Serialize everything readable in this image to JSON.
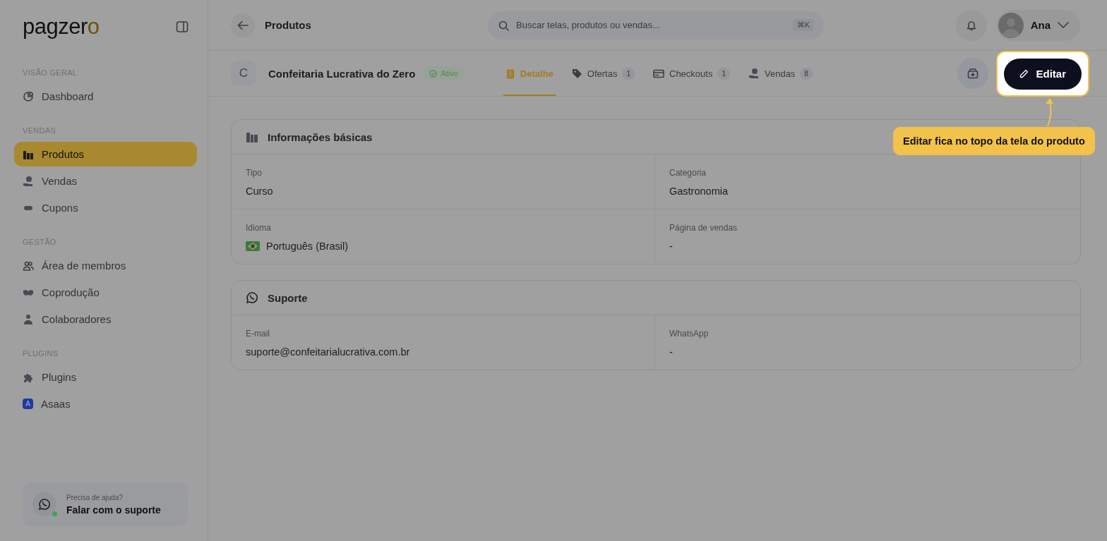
{
  "logo": {
    "text": "pagzero"
  },
  "sidebar": {
    "sections": [
      {
        "title": "VISÃO GERAL",
        "items": [
          {
            "label": "Dashboard",
            "selected": false
          }
        ]
      },
      {
        "title": "VENDAS",
        "items": [
          {
            "label": "Produtos",
            "selected": true
          },
          {
            "label": "Vendas",
            "selected": false
          },
          {
            "label": "Cupons",
            "selected": false
          }
        ]
      },
      {
        "title": "GESTÃO",
        "items": [
          {
            "label": "Área de membros",
            "selected": false
          },
          {
            "label": "Coprodução",
            "selected": false
          },
          {
            "label": "Colaboradores",
            "selected": false
          }
        ]
      },
      {
        "title": "PLUGINS",
        "items": [
          {
            "label": "Plugins",
            "selected": false
          },
          {
            "label": "Asaas",
            "selected": false,
            "badge": "A"
          }
        ]
      }
    ]
  },
  "help": {
    "hint": "Precisa de ajuda?",
    "link": "Falar com o suporte",
    "online": true
  },
  "topbar": {
    "title": "Produtos",
    "search": {
      "placeholder": "Buscar telas, produtos ou vendas...",
      "shortcut": "⌘K"
    },
    "user": "Ana"
  },
  "product": {
    "initial": "C",
    "name": "Confeitaria Lucrativa do Zero",
    "status": "Ativo",
    "tabs": [
      {
        "label": "Detalhe",
        "selected": true
      },
      {
        "label": "Ofertas",
        "count": "1",
        "selected": false
      },
      {
        "label": "Checkouts",
        "count": "1",
        "selected": false
      },
      {
        "label": "Vendas",
        "count": "8",
        "selected": false
      }
    ],
    "edit_button": "Editar"
  },
  "cards": [
    {
      "title": "Informações básicas",
      "fields": [
        {
          "kind": "text",
          "label": "Tipo",
          "value": "Curso"
        },
        {
          "kind": "text",
          "label": "Categoria",
          "value": "Gastronomia"
        },
        {
          "kind": "language",
          "label": "Idioma",
          "value": "Português (Brasil)"
        },
        {
          "kind": "text",
          "label": "Página de vendas",
          "value": "-"
        }
      ]
    },
    {
      "title": "Suporte",
      "fields": [
        {
          "kind": "text",
          "label": "E-mail",
          "value": "suporte@confeitarialucrativa.com.br"
        },
        {
          "kind": "text",
          "label": "WhatsApp",
          "value": "-"
        }
      ]
    }
  ],
  "callout": {
    "text": "Editar fica no topo da tela do produto"
  }
}
